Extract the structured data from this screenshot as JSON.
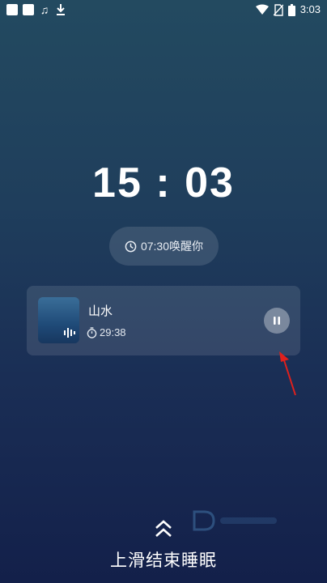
{
  "status_bar": {
    "time": "3:03",
    "left_icons": [
      "notification-square-icon",
      "notification-square-icon",
      "music-note-icon",
      "download-icon"
    ],
    "right_icons": [
      "wifi-icon",
      "no-sim-icon",
      "battery-icon"
    ]
  },
  "clock": {
    "time": "15 : 03"
  },
  "alarm": {
    "label": "07:30唤醒你",
    "icon": "clock-icon"
  },
  "player": {
    "title": "山水",
    "remaining": "29:38",
    "cover_icon": "audio-wave-icon",
    "control_icon": "pause-icon"
  },
  "footer": {
    "label": "上滑结束睡眠",
    "icon": "double-chevron-up-icon"
  },
  "colors": {
    "annotation_arrow": "#e0201c"
  }
}
